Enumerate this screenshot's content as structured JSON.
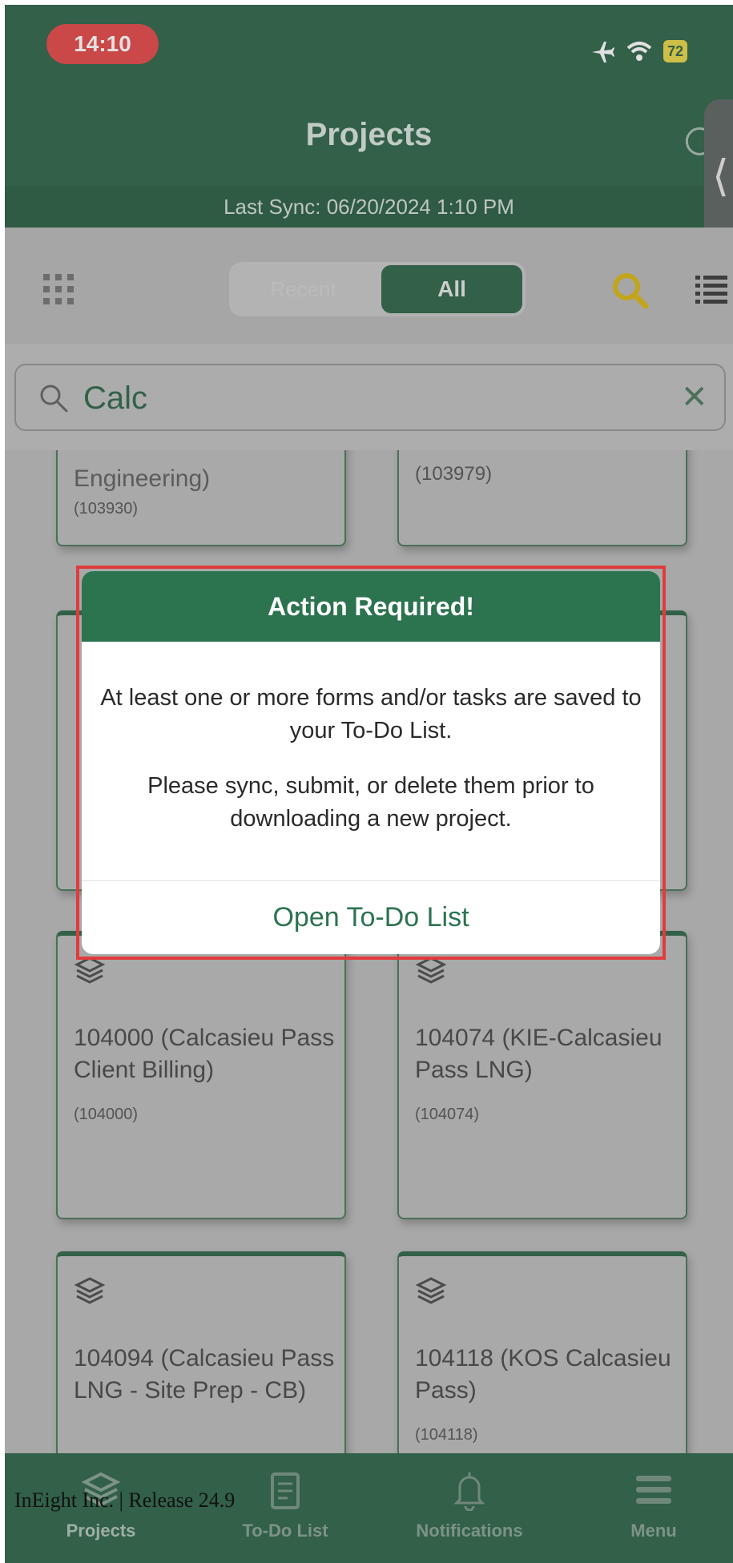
{
  "status_bar": {
    "time": "14:10",
    "battery": "72"
  },
  "header": {
    "title": "Projects",
    "last_sync": "Last Sync: 06/20/2024 1:10 PM"
  },
  "toolbar": {
    "segment_recent": "Recent",
    "segment_all": "All",
    "selected_segment": "All"
  },
  "search": {
    "value": "Calc",
    "placeholder": ""
  },
  "projects": [
    {
      "title": "Engineering)",
      "id": "(103930)"
    },
    {
      "title": "",
      "id": "(103979)"
    },
    {
      "title": "104000 (Calcasieu Pass Client Billing)",
      "id": "(104000)"
    },
    {
      "title": "104074 (KIE-Calcasieu Pass LNG)",
      "id": "(104074)"
    },
    {
      "title": "104094 (Calcasieu Pass LNG - Site Prep - CB)",
      "id": ""
    },
    {
      "title": "104118 (KOS Calcasieu Pass)",
      "id": "(104118)"
    }
  ],
  "modal": {
    "title": "Action Required!",
    "message1": "At least one or more forms and/or tasks are saved to your To-Do List.",
    "message2": "Please sync, submit, or delete them prior to downloading a new project.",
    "action": "Open To-Do List"
  },
  "tabbar": {
    "projects": "Projects",
    "todo": "To-Do List",
    "notifications": "Notifications",
    "menu": "Menu"
  },
  "footer_note": "InEight Inc.  |  Release 24.9",
  "colors": {
    "brand_green": "#1f5a3b",
    "alert_red": "#e23b3b",
    "search_accent": "#d8b200"
  }
}
